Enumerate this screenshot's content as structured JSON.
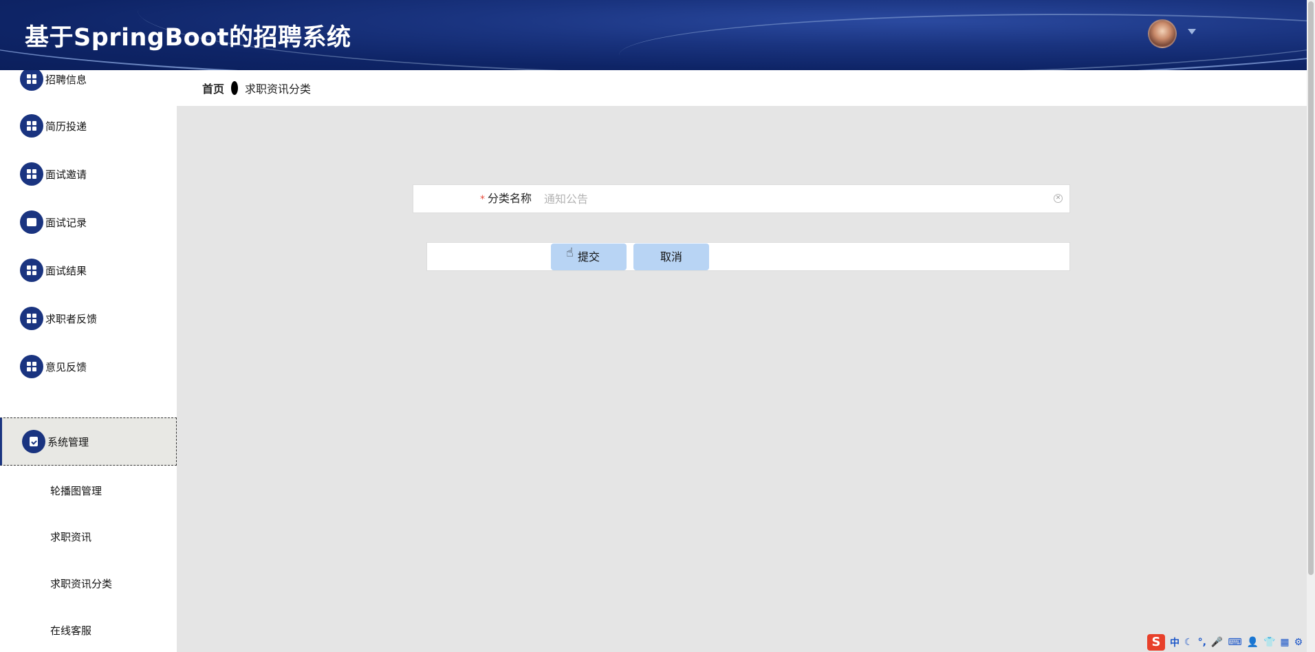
{
  "header": {
    "title": "基于SpringBoot的招聘系统"
  },
  "breadcrumb": {
    "home": "首页",
    "current": "求职资讯分类"
  },
  "sidebar": {
    "items": [
      {
        "label": "招聘信息",
        "icon": "grid-icon"
      },
      {
        "label": "简历投递",
        "icon": "grid-icon"
      },
      {
        "label": "面试邀请",
        "icon": "grid-icon"
      },
      {
        "label": "面试记录",
        "icon": "folder-icon"
      },
      {
        "label": "面试结果",
        "icon": "grid-icon"
      },
      {
        "label": "求职者反馈",
        "icon": "grid-icon"
      },
      {
        "label": "意见反馈",
        "icon": "grid-icon"
      },
      {
        "label": "系统管理",
        "icon": "clipboard-icon"
      }
    ],
    "subitems": [
      {
        "label": "轮播图管理"
      },
      {
        "label": "求职资讯"
      },
      {
        "label": "求职资讯分类"
      },
      {
        "label": "在线客服"
      }
    ]
  },
  "form": {
    "field_label": "分类名称",
    "required_mark": "*",
    "field_placeholder": "通知公告",
    "field_value": "",
    "submit_label": "提交",
    "cancel_label": "取消"
  },
  "ime": {
    "logo": "S",
    "mode": "中",
    "glyphs": [
      "☾",
      "°,",
      "🎤",
      "⌨",
      "👤",
      "👕",
      "▦",
      "⚙"
    ]
  },
  "colors": {
    "primary": "#1a3480",
    "button": "#b8d4f4",
    "required": "#e74c3c"
  }
}
